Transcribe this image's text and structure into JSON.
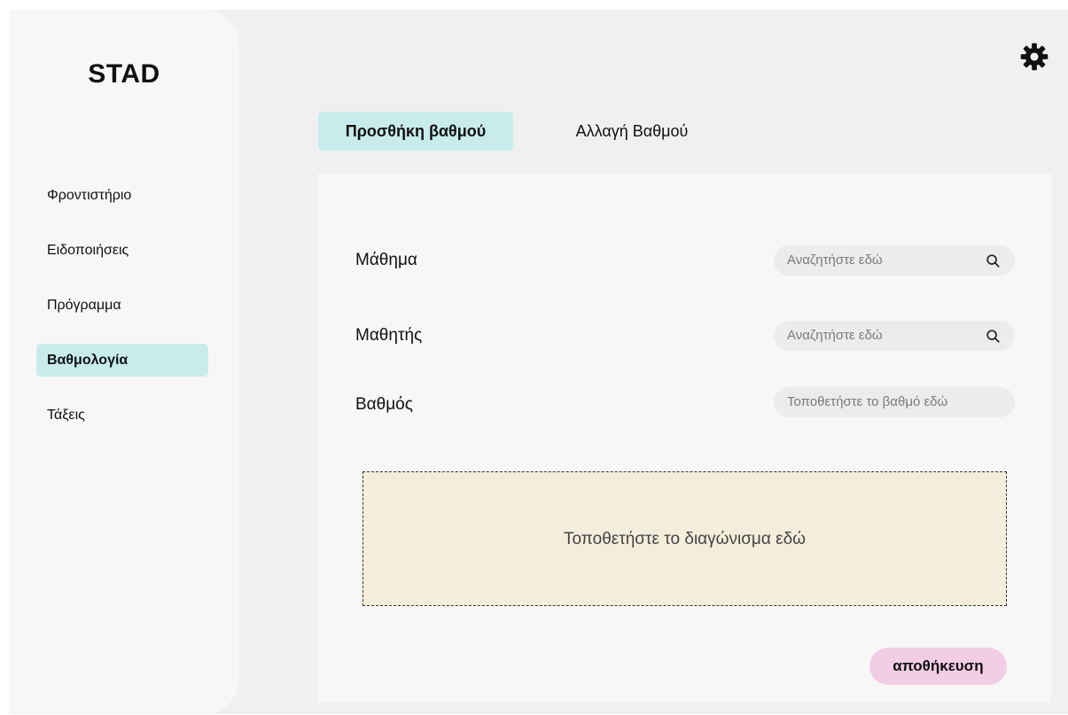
{
  "app": {
    "logo": "STAD"
  },
  "sidebar": {
    "items": [
      {
        "label": "Φροντιστήριο",
        "active": false
      },
      {
        "label": "Ειδοποιήσεις",
        "active": false
      },
      {
        "label": "Πρόγραμμα",
        "active": false
      },
      {
        "label": "Βαθμολογία",
        "active": true
      },
      {
        "label": "Τάξεις",
        "active": false
      }
    ]
  },
  "header": {
    "settings_icon": "gear-icon"
  },
  "tabs": [
    {
      "label": "Προσθήκη βαθμού",
      "active": true
    },
    {
      "label": "Αλλαγή Βαθμού",
      "active": false
    }
  ],
  "form": {
    "course": {
      "label": "Μάθημα",
      "placeholder": "Αναζητήστε εδώ",
      "icon": "search-icon"
    },
    "student": {
      "label": "Μαθητής",
      "placeholder": "Αναζητήστε εδώ",
      "icon": "search-icon"
    },
    "grade": {
      "label": "Βαθμός",
      "placeholder": "Τοποθετήστε το βαθμό εδώ"
    },
    "dropzone_text": "Τοποθετήστε το διαγώνισμα εδώ",
    "save_label": "αποθήκευση"
  },
  "colors": {
    "active_tab": "#c8ecec",
    "save_button": "#f2cde6",
    "dropzone": "#f3eddb",
    "background": "#f0f0f0",
    "panel": "#f7f7f7"
  }
}
